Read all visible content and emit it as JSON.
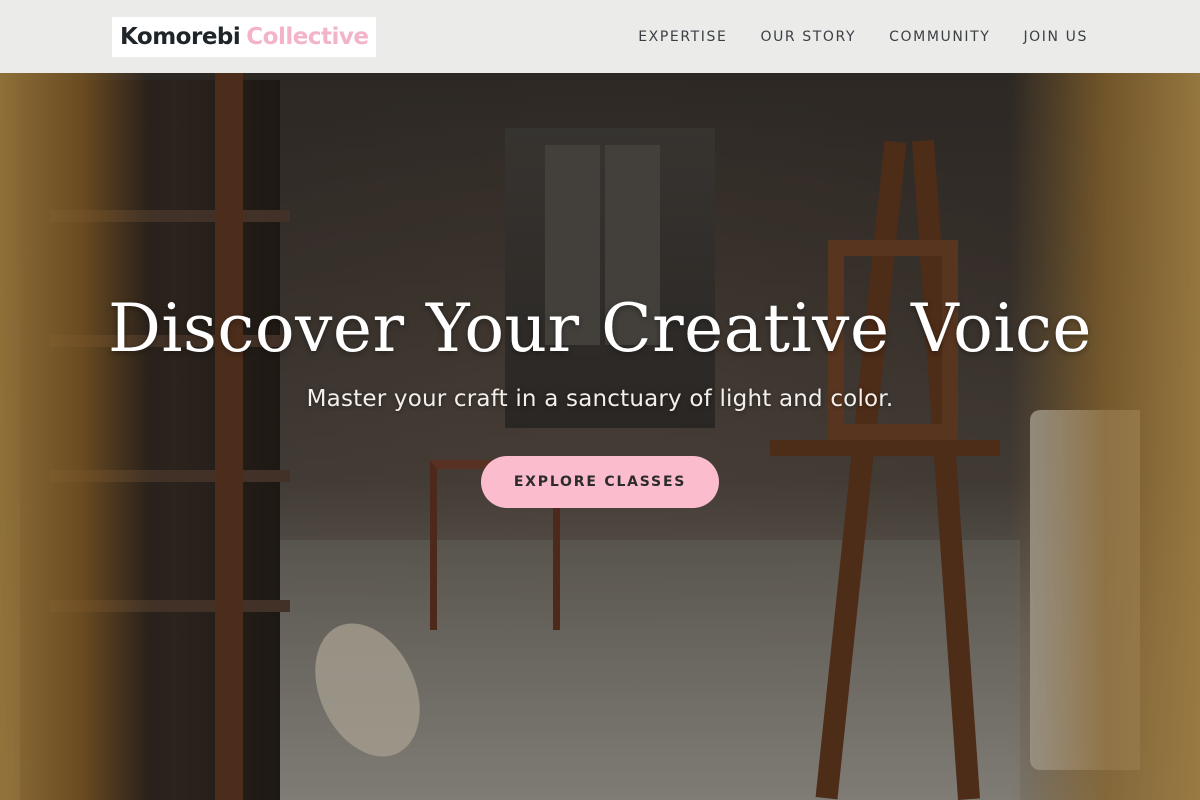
{
  "brand": {
    "name": "Komorebi",
    "accent": "Collective"
  },
  "nav": {
    "links": [
      {
        "label": "EXPERTISE"
      },
      {
        "label": "OUR STORY"
      },
      {
        "label": "COMMUNITY"
      },
      {
        "label": "JOIN US"
      }
    ]
  },
  "hero": {
    "title": "Discover Your Creative Voice",
    "subtitle": "Master your craft in a sanctuary of light and color.",
    "cta_label": "EXPLORE CLASSES"
  },
  "colors": {
    "brand_text": "#1f2428",
    "brand_accent": "#f3b3c9",
    "cta_background": "#fbbccd",
    "nav_background": "#f8f8f6"
  }
}
